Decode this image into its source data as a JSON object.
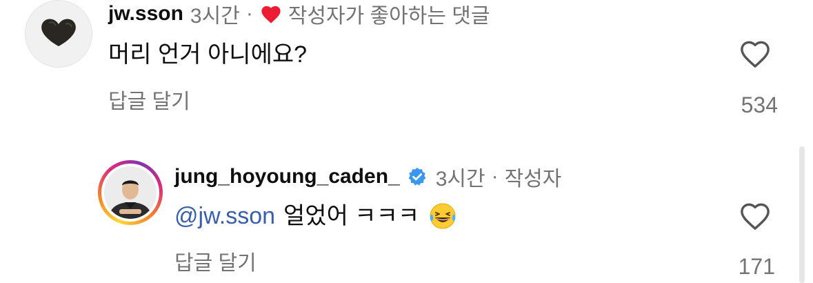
{
  "comments": [
    {
      "username": "jw.sson",
      "time": "3시간",
      "separator": "·",
      "liked_by_author_label": "작성자가 좋아하는 댓글",
      "text": "머리 언거 아니에요?",
      "reply_label": "답글 달기",
      "like_count": "534",
      "avatar_icon": "heart-shaped-object-avatar"
    },
    {
      "username": "jung_hoyoung_caden_",
      "verified": true,
      "time": "3시간",
      "separator": "·",
      "author_label": "작성자",
      "mention": "@jw.sson",
      "text": "얼었어 ㅋㅋㅋ",
      "emoji": "😂",
      "reply_label": "답글 달기",
      "like_count": "171",
      "avatar_icon": "chef-portrait-avatar"
    }
  ],
  "colors": {
    "heart_red": "#ed1c33",
    "verified_blue": "#3897f0",
    "mention_blue": "#3a5faa",
    "muted_gray": "#737373"
  }
}
